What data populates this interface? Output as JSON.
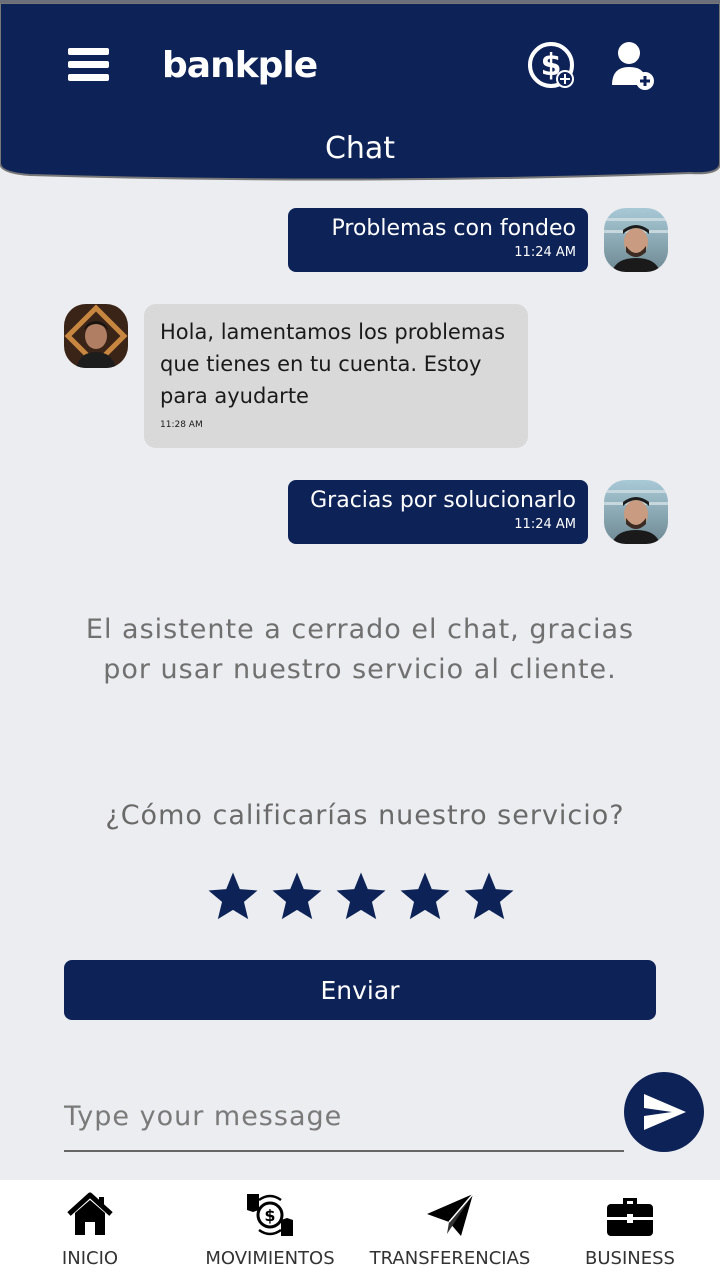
{
  "header": {
    "logo_text": "bankple",
    "title": "Chat",
    "icons": {
      "menu": "menu-icon",
      "money": "money-add-icon",
      "user": "user-add-icon"
    }
  },
  "messages": [
    {
      "direction": "out",
      "text": "Problemas con fondeo",
      "time": "11:24 AM"
    },
    {
      "direction": "in",
      "text": "Hola, lamentamos los problemas que tienes en tu cuenta. Estoy para ayudarte",
      "time": "11:28 AM"
    },
    {
      "direction": "out",
      "text": "Gracias por solucionarlo",
      "time": "11:24 AM"
    }
  ],
  "closed_notice": "El asistente a cerrado el chat, gracias por usar nuestro servicio al cliente.",
  "rating": {
    "question": "¿Cómo calificarías nuestro servicio?",
    "max_stars": 5
  },
  "submit_label": "Enviar",
  "composer": {
    "placeholder": "Type your message",
    "value": ""
  },
  "nav": [
    {
      "label": "INICIO",
      "icon": "home-icon"
    },
    {
      "label": "MOVIMIENTOS",
      "icon": "money-exchange-icon"
    },
    {
      "label": "TRANSFERENCIAS",
      "icon": "paper-plane-icon"
    },
    {
      "label": "BUSINESS",
      "icon": "briefcase-icon"
    }
  ],
  "colors": {
    "brand": "#0d2257",
    "background": "#ebedf0",
    "incoming_bubble": "#d9d9d9"
  }
}
